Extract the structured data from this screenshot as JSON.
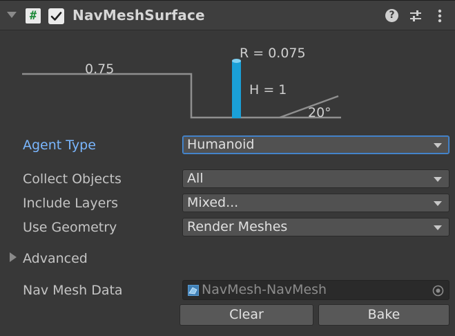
{
  "header": {
    "title": "NavMeshSurface",
    "script_icon_glyph": "#",
    "enabled": true
  },
  "diagram": {
    "step_height": "0.75",
    "radius": "R = 0.075",
    "height": "H = 1",
    "slope": "20°",
    "agent_color": "#1aa0d8"
  },
  "properties": {
    "agent_type": {
      "label": "Agent Type",
      "value": "Humanoid"
    },
    "collect_objects": {
      "label": "Collect Objects",
      "value": "All"
    },
    "include_layers": {
      "label": "Include Layers",
      "value": "Mixed..."
    },
    "use_geometry": {
      "label": "Use Geometry",
      "value": "Render Meshes"
    }
  },
  "advanced": {
    "label": "Advanced",
    "expanded": false
  },
  "nav_mesh_data": {
    "label": "Nav Mesh Data",
    "value": "NavMesh-NavMesh"
  },
  "buttons": {
    "clear": "Clear",
    "bake": "Bake"
  },
  "colors": {
    "background": "#383838",
    "accent_label": "#7ab7ff",
    "focus_border": "#4d8fd6"
  }
}
